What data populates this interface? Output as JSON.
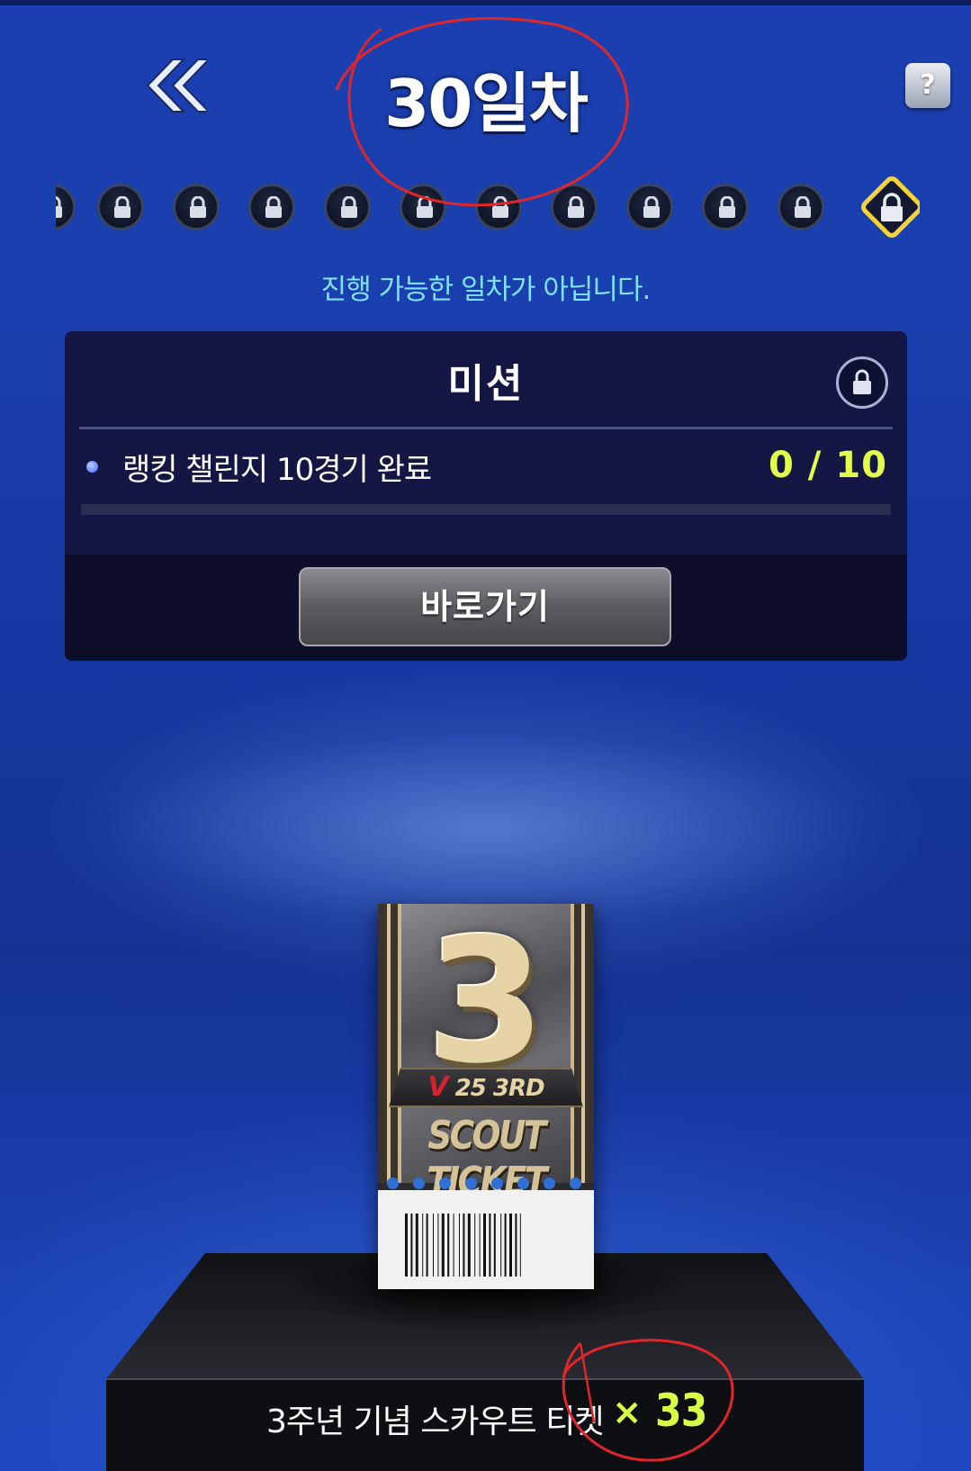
{
  "header": {
    "day_title": "30일차",
    "help_label": "?"
  },
  "days": {
    "node_count": 11,
    "current_locked": true
  },
  "notice": "진행 가능한 일차가 아닙니다.",
  "mission": {
    "title": "미션",
    "item_text": "랭킹 챌린지 10경기 완료",
    "count_text": "0 / 10",
    "progress": 0.0,
    "goto_label": "바로가기"
  },
  "reward": {
    "ticket": {
      "numeral": "3",
      "edition_v": "V",
      "edition": "25 3RD",
      "label": "SCOUT TICKET"
    },
    "name": "3주년 기념 스카우트 티켓",
    "multiplier_symbol": "×",
    "quantity": "33"
  },
  "colors": {
    "accent_yellow": "#e3ff4a",
    "notice_cyan": "#7fe1f4",
    "current_day_border": "#f2d33a",
    "annotation_red": "#e0262b"
  }
}
